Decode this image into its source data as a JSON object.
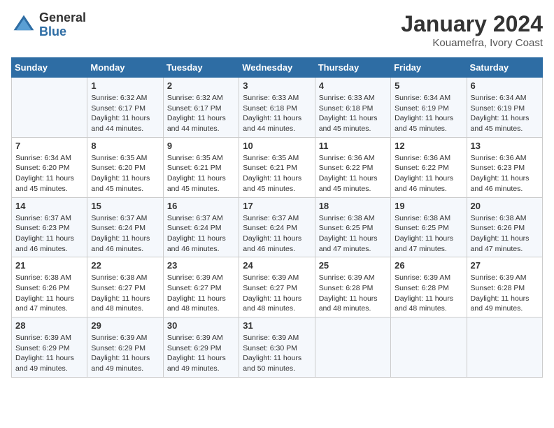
{
  "header": {
    "logo_general": "General",
    "logo_blue": "Blue",
    "month_title": "January 2024",
    "location": "Kouamefra, Ivory Coast"
  },
  "weekdays": [
    "Sunday",
    "Monday",
    "Tuesday",
    "Wednesday",
    "Thursday",
    "Friday",
    "Saturday"
  ],
  "weeks": [
    [
      {
        "day": "",
        "sunrise": "",
        "sunset": "",
        "daylight": ""
      },
      {
        "day": "1",
        "sunrise": "Sunrise: 6:32 AM",
        "sunset": "Sunset: 6:17 PM",
        "daylight": "Daylight: 11 hours and 44 minutes."
      },
      {
        "day": "2",
        "sunrise": "Sunrise: 6:32 AM",
        "sunset": "Sunset: 6:17 PM",
        "daylight": "Daylight: 11 hours and 44 minutes."
      },
      {
        "day": "3",
        "sunrise": "Sunrise: 6:33 AM",
        "sunset": "Sunset: 6:18 PM",
        "daylight": "Daylight: 11 hours and 44 minutes."
      },
      {
        "day": "4",
        "sunrise": "Sunrise: 6:33 AM",
        "sunset": "Sunset: 6:18 PM",
        "daylight": "Daylight: 11 hours and 45 minutes."
      },
      {
        "day": "5",
        "sunrise": "Sunrise: 6:34 AM",
        "sunset": "Sunset: 6:19 PM",
        "daylight": "Daylight: 11 hours and 45 minutes."
      },
      {
        "day": "6",
        "sunrise": "Sunrise: 6:34 AM",
        "sunset": "Sunset: 6:19 PM",
        "daylight": "Daylight: 11 hours and 45 minutes."
      }
    ],
    [
      {
        "day": "7",
        "sunrise": "Sunrise: 6:34 AM",
        "sunset": "Sunset: 6:20 PM",
        "daylight": "Daylight: 11 hours and 45 minutes."
      },
      {
        "day": "8",
        "sunrise": "Sunrise: 6:35 AM",
        "sunset": "Sunset: 6:20 PM",
        "daylight": "Daylight: 11 hours and 45 minutes."
      },
      {
        "day": "9",
        "sunrise": "Sunrise: 6:35 AM",
        "sunset": "Sunset: 6:21 PM",
        "daylight": "Daylight: 11 hours and 45 minutes."
      },
      {
        "day": "10",
        "sunrise": "Sunrise: 6:35 AM",
        "sunset": "Sunset: 6:21 PM",
        "daylight": "Daylight: 11 hours and 45 minutes."
      },
      {
        "day": "11",
        "sunrise": "Sunrise: 6:36 AM",
        "sunset": "Sunset: 6:22 PM",
        "daylight": "Daylight: 11 hours and 45 minutes."
      },
      {
        "day": "12",
        "sunrise": "Sunrise: 6:36 AM",
        "sunset": "Sunset: 6:22 PM",
        "daylight": "Daylight: 11 hours and 46 minutes."
      },
      {
        "day": "13",
        "sunrise": "Sunrise: 6:36 AM",
        "sunset": "Sunset: 6:23 PM",
        "daylight": "Daylight: 11 hours and 46 minutes."
      }
    ],
    [
      {
        "day": "14",
        "sunrise": "Sunrise: 6:37 AM",
        "sunset": "Sunset: 6:23 PM",
        "daylight": "Daylight: 11 hours and 46 minutes."
      },
      {
        "day": "15",
        "sunrise": "Sunrise: 6:37 AM",
        "sunset": "Sunset: 6:24 PM",
        "daylight": "Daylight: 11 hours and 46 minutes."
      },
      {
        "day": "16",
        "sunrise": "Sunrise: 6:37 AM",
        "sunset": "Sunset: 6:24 PM",
        "daylight": "Daylight: 11 hours and 46 minutes."
      },
      {
        "day": "17",
        "sunrise": "Sunrise: 6:37 AM",
        "sunset": "Sunset: 6:24 PM",
        "daylight": "Daylight: 11 hours and 46 minutes."
      },
      {
        "day": "18",
        "sunrise": "Sunrise: 6:38 AM",
        "sunset": "Sunset: 6:25 PM",
        "daylight": "Daylight: 11 hours and 47 minutes."
      },
      {
        "day": "19",
        "sunrise": "Sunrise: 6:38 AM",
        "sunset": "Sunset: 6:25 PM",
        "daylight": "Daylight: 11 hours and 47 minutes."
      },
      {
        "day": "20",
        "sunrise": "Sunrise: 6:38 AM",
        "sunset": "Sunset: 6:26 PM",
        "daylight": "Daylight: 11 hours and 47 minutes."
      }
    ],
    [
      {
        "day": "21",
        "sunrise": "Sunrise: 6:38 AM",
        "sunset": "Sunset: 6:26 PM",
        "daylight": "Daylight: 11 hours and 47 minutes."
      },
      {
        "day": "22",
        "sunrise": "Sunrise: 6:38 AM",
        "sunset": "Sunset: 6:27 PM",
        "daylight": "Daylight: 11 hours and 48 minutes."
      },
      {
        "day": "23",
        "sunrise": "Sunrise: 6:39 AM",
        "sunset": "Sunset: 6:27 PM",
        "daylight": "Daylight: 11 hours and 48 minutes."
      },
      {
        "day": "24",
        "sunrise": "Sunrise: 6:39 AM",
        "sunset": "Sunset: 6:27 PM",
        "daylight": "Daylight: 11 hours and 48 minutes."
      },
      {
        "day": "25",
        "sunrise": "Sunrise: 6:39 AM",
        "sunset": "Sunset: 6:28 PM",
        "daylight": "Daylight: 11 hours and 48 minutes."
      },
      {
        "day": "26",
        "sunrise": "Sunrise: 6:39 AM",
        "sunset": "Sunset: 6:28 PM",
        "daylight": "Daylight: 11 hours and 48 minutes."
      },
      {
        "day": "27",
        "sunrise": "Sunrise: 6:39 AM",
        "sunset": "Sunset: 6:28 PM",
        "daylight": "Daylight: 11 hours and 49 minutes."
      }
    ],
    [
      {
        "day": "28",
        "sunrise": "Sunrise: 6:39 AM",
        "sunset": "Sunset: 6:29 PM",
        "daylight": "Daylight: 11 hours and 49 minutes."
      },
      {
        "day": "29",
        "sunrise": "Sunrise: 6:39 AM",
        "sunset": "Sunset: 6:29 PM",
        "daylight": "Daylight: 11 hours and 49 minutes."
      },
      {
        "day": "30",
        "sunrise": "Sunrise: 6:39 AM",
        "sunset": "Sunset: 6:29 PM",
        "daylight": "Daylight: 11 hours and 49 minutes."
      },
      {
        "day": "31",
        "sunrise": "Sunrise: 6:39 AM",
        "sunset": "Sunset: 6:30 PM",
        "daylight": "Daylight: 11 hours and 50 minutes."
      },
      {
        "day": "",
        "sunrise": "",
        "sunset": "",
        "daylight": ""
      },
      {
        "day": "",
        "sunrise": "",
        "sunset": "",
        "daylight": ""
      },
      {
        "day": "",
        "sunrise": "",
        "sunset": "",
        "daylight": ""
      }
    ]
  ]
}
